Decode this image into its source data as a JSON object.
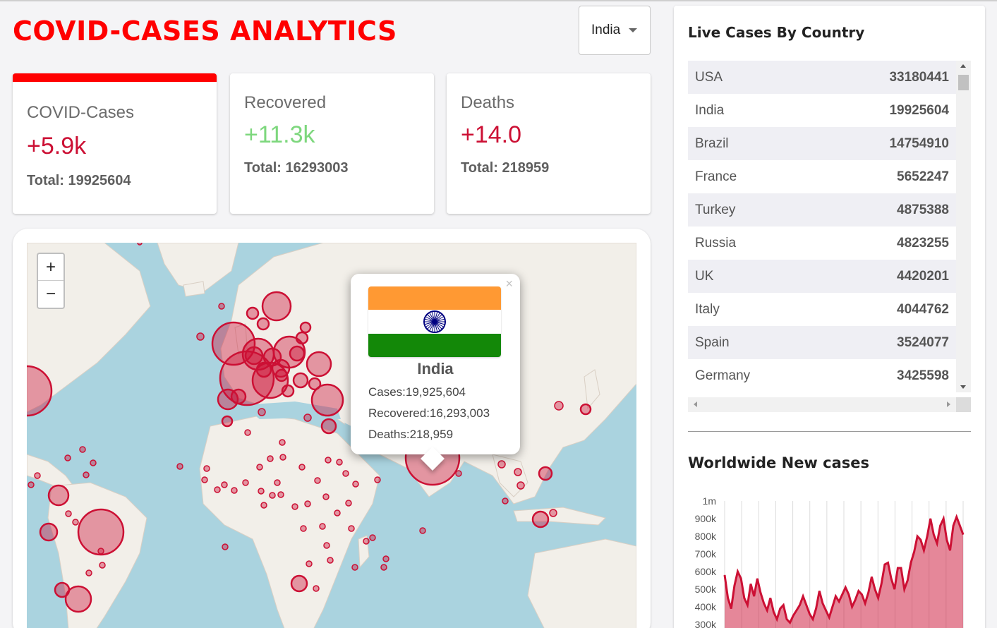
{
  "app": {
    "title": "COVID-CASES ANALYTICS"
  },
  "country_selector": {
    "selected": "India"
  },
  "stats": [
    {
      "label": "COVID-Cases",
      "change": "+5.9k",
      "total_label": "Total: 19925604",
      "color": "#cc1034",
      "selected": true
    },
    {
      "label": "Recovered",
      "change": "+11.3k",
      "total_label": "Total: 16293003",
      "color": "#7dd71d",
      "selected": false
    },
    {
      "label": "Deaths",
      "change": "+14.0",
      "total_label": "Total: 218959",
      "color": "#cc1034",
      "selected": false
    }
  ],
  "map": {
    "zoom_in": "+",
    "zoom_out": "−",
    "popup": {
      "close": "×",
      "country": "India",
      "cases": "Cases:19,925,604",
      "recovered": "Recovered:16,293,003",
      "deaths": "Deaths:218,959",
      "flag_colors": [
        "#ff9933",
        "#ffffff",
        "#138808"
      ],
      "chakra_color": "#000080"
    },
    "colors": {
      "water": "#aad3df",
      "land": "#f2efe9",
      "marker": "#cc1034"
    }
  },
  "live_cases": {
    "title": "Live Cases By Country",
    "rows": [
      {
        "country": "USA",
        "cases": "33180441"
      },
      {
        "country": "India",
        "cases": "19925604"
      },
      {
        "country": "Brazil",
        "cases": "14754910"
      },
      {
        "country": "France",
        "cases": "5652247"
      },
      {
        "country": "Turkey",
        "cases": "4875388"
      },
      {
        "country": "Russia",
        "cases": "4823255"
      },
      {
        "country": "UK",
        "cases": "4420201"
      },
      {
        "country": "Italy",
        "cases": "4044762"
      },
      {
        "country": "Spain",
        "cases": "3524077"
      },
      {
        "country": "Germany",
        "cases": "3425598"
      }
    ]
  },
  "chart_title": "Worldwide New cases",
  "chart_data": {
    "type": "area",
    "title": "Worldwide New cases",
    "xlabel": "",
    "ylabel": "",
    "y_tick_labels": [
      "1m",
      "900k",
      "800k",
      "700k",
      "600k",
      "500k",
      "400k",
      "300k"
    ],
    "y_ticks": [
      1000000,
      900000,
      800000,
      700000,
      600000,
      500000,
      400000,
      300000
    ],
    "ylim": [
      300000,
      1000000
    ],
    "grid": "vertical",
    "color": "#cc1034",
    "fill": "rgba(204,16,52,0.5)",
    "values": [
      580000,
      450000,
      390000,
      520000,
      600000,
      560000,
      450000,
      410000,
      530000,
      460000,
      560000,
      480000,
      420000,
      380000,
      450000,
      370000,
      330000,
      390000,
      410000,
      330000,
      310000,
      350000,
      380000,
      410000,
      460000,
      410000,
      360000,
      330000,
      390000,
      490000,
      420000,
      380000,
      340000,
      400000,
      460000,
      430000,
      470000,
      510000,
      470000,
      400000,
      440000,
      490000,
      470000,
      420000,
      480000,
      570000,
      500000,
      450000,
      530000,
      640000,
      650000,
      560000,
      500000,
      620000,
      620000,
      500000,
      550000,
      650000,
      710000,
      800000,
      780000,
      720000,
      800000,
      900000,
      810000,
      760000,
      860000,
      900000,
      780000,
      720000,
      860000,
      910000,
      860000,
      810000
    ]
  }
}
